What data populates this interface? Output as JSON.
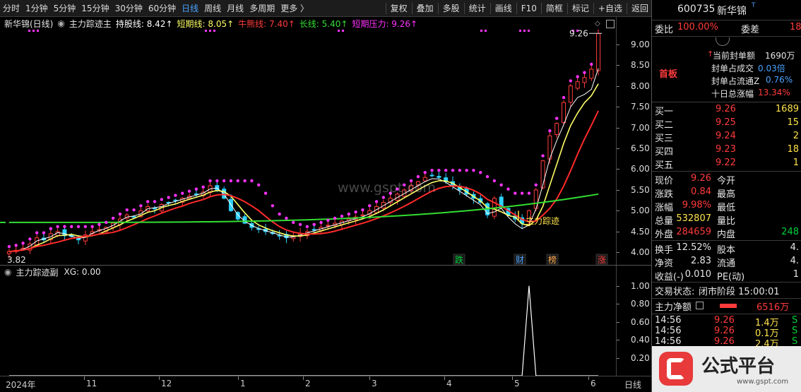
{
  "toolbar": {
    "periods": [
      "分时",
      "1分钟",
      "5分钟",
      "15分钟",
      "30分钟",
      "60分钟",
      "日线",
      "周线",
      "月线",
      "多周期",
      "更多 〉"
    ],
    "active_period": "日线",
    "actions": [
      "复权",
      "叠加",
      "多股",
      "统计",
      "画线",
      "F10",
      "简框",
      "标记",
      "+自选",
      "返回"
    ]
  },
  "title_bar": {
    "stock_label": "新华锦(日线)",
    "indicator_name": "主力踪迹主",
    "hold_line": "持股线: 8.42↑",
    "short_line": "短期线: 8.05↑",
    "bull_line": "牛熊线: 7.40↑",
    "long_line": "长线: 5.40↑",
    "pressure": "短期压力: 9.26↑"
  },
  "main_axis": {
    "ticks": [
      "9.00",
      "8.50",
      "8.00",
      "7.50",
      "7.00",
      "6.50",
      "6.00",
      "5.50",
      "5.00",
      "4.50",
      "4.00"
    ]
  },
  "annotations": {
    "high_label": "9.26",
    "low_label": "3.82",
    "signal_label": "主力踪迹",
    "watermark": "www.gspt.com",
    "events": [
      "跌",
      "财",
      "榜",
      "涨"
    ]
  },
  "sub": {
    "title": "主力踪迹副",
    "xg": "XG: 0.00",
    "ticks": [
      "1.00",
      "0.80",
      "0.60",
      "0.40",
      "0.20"
    ]
  },
  "date_axis": {
    "labels": [
      "2024年",
      "11",
      "12",
      "1",
      "2",
      "3",
      "4",
      "5",
      "6",
      "日线"
    ]
  },
  "chart_data": {
    "type": "candlestick",
    "x_range": [
      "2024-10",
      "2025-06"
    ],
    "ylim": [
      3.82,
      9.26
    ],
    "main_series": {
      "close": [
        4.02,
        4.05,
        4.1,
        4.2,
        4.35,
        4.3,
        4.45,
        4.5,
        4.4,
        4.38,
        4.3,
        4.42,
        4.5,
        4.55,
        4.6,
        4.7,
        4.8,
        4.9,
        4.85,
        5.0,
        5.1,
        5.05,
        5.15,
        5.2,
        5.25,
        5.3,
        5.35,
        5.4,
        5.45,
        5.6,
        5.5,
        5.3,
        5.0,
        4.8,
        4.7,
        4.6,
        4.55,
        4.5,
        4.45,
        4.4,
        4.35,
        4.4,
        4.45,
        4.5,
        4.55,
        4.6,
        4.65,
        4.7,
        4.75,
        4.8,
        4.85,
        4.9,
        5.0,
        5.1,
        5.2,
        5.3,
        5.4,
        5.5,
        5.6,
        5.7,
        5.8,
        5.85,
        5.8,
        5.7,
        5.6,
        5.5,
        5.4,
        5.3,
        5.2,
        4.9,
        5.3,
        5.1,
        4.9,
        4.8,
        4.7,
        5.0,
        5.5,
        6.2,
        6.8,
        7.1,
        7.6,
        8.0,
        8.1,
        8.2,
        8.4,
        9.26
      ],
      "hold_line_last": 8.42,
      "short_line_last": 8.05,
      "bull_line_last": 7.4,
      "long_line_last": 5.4,
      "short_pressure_last": 9.26
    },
    "sub_series": {
      "name": "XG",
      "values": [
        0,
        0,
        0,
        0,
        0,
        0,
        0,
        0,
        0,
        0,
        0,
        0,
        0,
        0,
        0,
        0,
        0,
        0,
        0,
        0,
        0,
        0,
        0,
        0,
        0,
        0,
        0,
        0,
        0,
        0,
        0,
        0,
        0,
        0,
        0,
        0,
        0,
        0,
        0,
        0,
        0,
        0,
        0,
        0,
        0,
        0,
        0,
        0,
        0,
        0,
        0,
        0,
        0,
        0,
        0,
        0,
        0,
        0,
        0,
        0,
        0,
        0,
        0,
        0,
        0,
        0,
        0,
        0,
        0,
        0,
        0,
        0,
        0,
        0,
        0,
        1,
        0,
        0,
        0,
        0,
        0,
        0,
        0,
        0,
        0,
        0
      ],
      "ylim": [
        0,
        1.1
      ]
    },
    "colors": {
      "up": "#ff3b3b",
      "down": "#2ed2ff",
      "hold_line": "#ffffff",
      "short_line": "#ffff66",
      "bull_line": "#ff2a2a",
      "long_line": "#33dd33",
      "pressure": "#ff33ff"
    }
  },
  "right_panel": {
    "code": "600735",
    "name": "新华锦",
    "weibi_label": "委比",
    "weibi": "100.00%",
    "weicha_label": "委差",
    "weicha": "18",
    "board_label": "首板",
    "seal_amount_label": "当前封单额",
    "seal_amount": "1690万",
    "seal_vs_trade_label": "封单占成交",
    "seal_vs_trade": "0.03倍",
    "seal_vs_float_label": "封单占流通Z",
    "seal_vs_float": "0.76%",
    "ten_day_label": "十日总涨幅",
    "ten_day": "13.34%",
    "bids": [
      {
        "label": "买一",
        "price": "9.26",
        "vol": "1689"
      },
      {
        "label": "买二",
        "price": "9.25",
        "vol": "15"
      },
      {
        "label": "买三",
        "price": "9.24",
        "vol": "2"
      },
      {
        "label": "买四",
        "price": "9.23",
        "vol": "18"
      },
      {
        "label": "买五",
        "price": "9.22",
        "vol": "1"
      }
    ],
    "quote": [
      {
        "l1": "现价",
        "v1": "9.26",
        "l2": "今开",
        "v2": ""
      },
      {
        "l1": "涨跌",
        "v1": "0.84",
        "l2": "最高",
        "v2": ""
      },
      {
        "l1": "涨幅",
        "v1": "9.98%",
        "l2": "最低",
        "v2": ""
      },
      {
        "l1": "总量",
        "v1": "532807",
        "l2": "量比",
        "v2": ""
      },
      {
        "l1": "外盘",
        "v1": "284659",
        "l2": "内盘",
        "v2": "248"
      }
    ],
    "stats": [
      {
        "l1": "换手",
        "v1": "12.52%",
        "l2": "股本",
        "v2": "4."
      },
      {
        "l1": "净资",
        "v1": "2.83",
        "l2": "流通",
        "v2": "4."
      },
      {
        "l1": "收益(-)",
        "v1": "0.010",
        "l2": "PE(动)",
        "v2": "1"
      }
    ],
    "trade_status_label": "交易状态:",
    "trade_status": "闭市阶段 15:00:01",
    "net_flow_label": "主力净额",
    "net_flow": "6516万",
    "ticks": [
      {
        "time": "14:56",
        "price": "9.26",
        "vol": "1.4万",
        "dir": "S"
      },
      {
        "time": "14:56",
        "price": "9.26",
        "vol": "0.1万",
        "dir": "S"
      },
      {
        "time": "14:56",
        "price": "9.26",
        "vol": "2.4万",
        "dir": "S"
      }
    ],
    "logo_text": "公式平台",
    "logo_url": "www.gspt.com"
  }
}
